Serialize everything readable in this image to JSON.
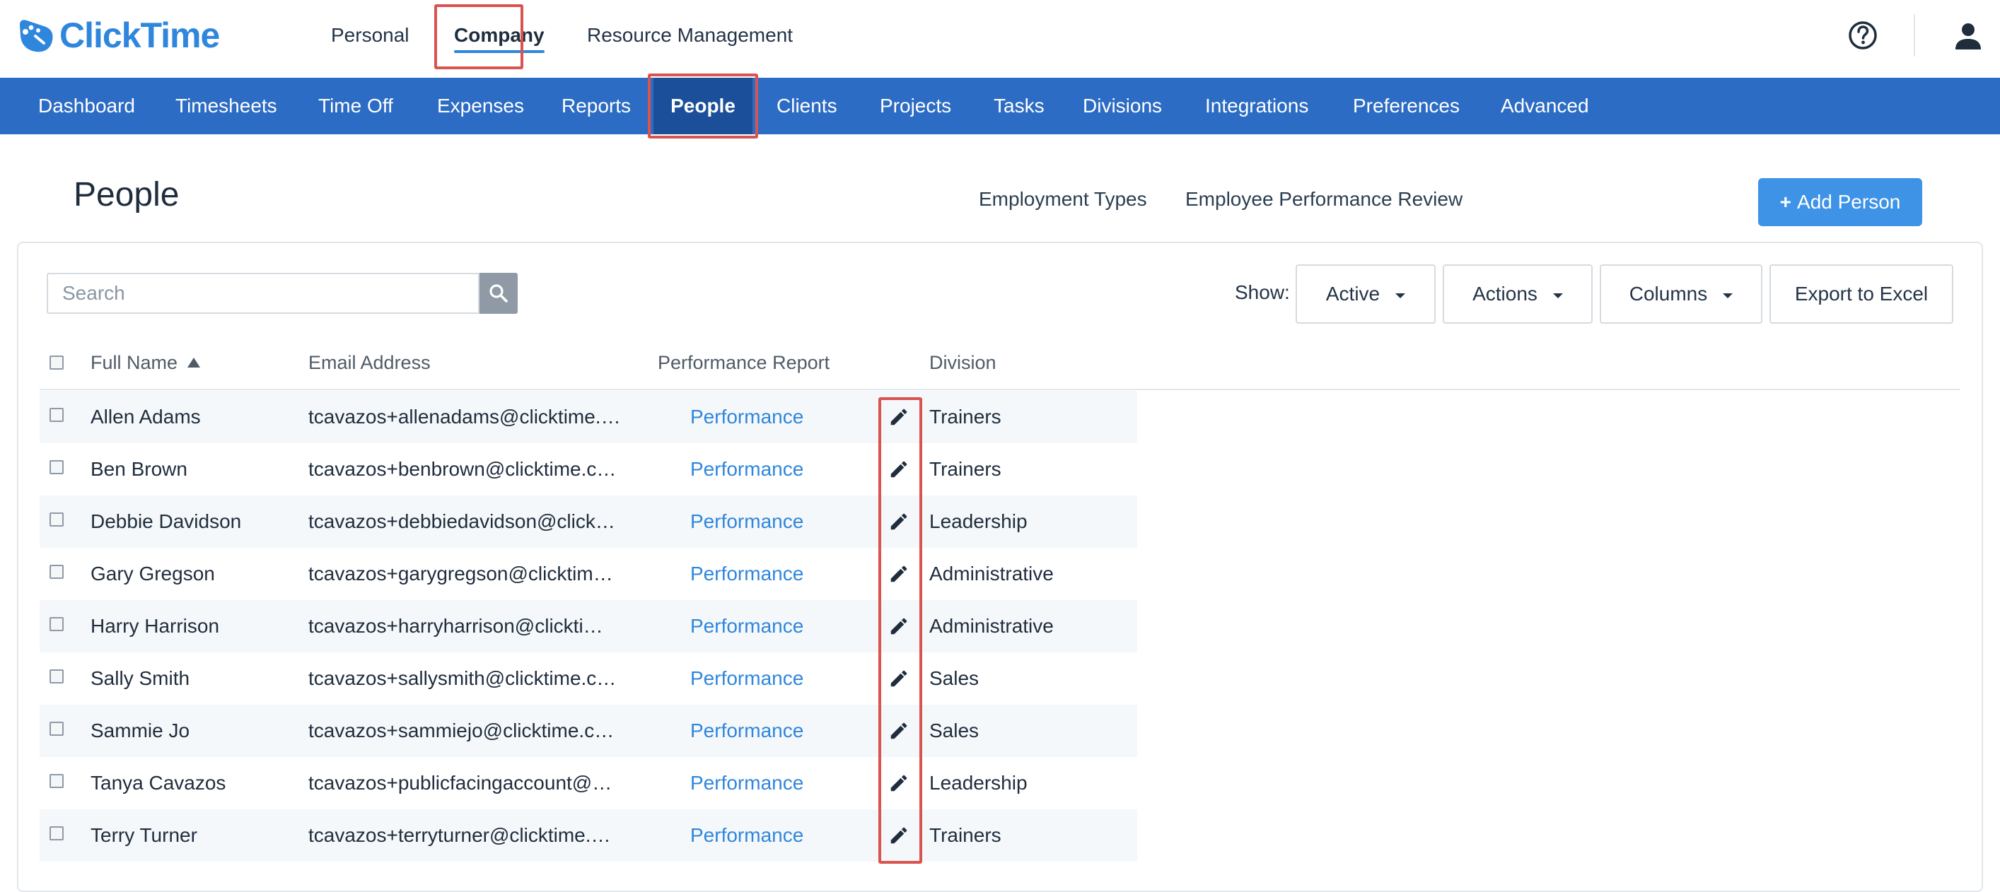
{
  "app": {
    "logo_text": "ClickTime",
    "brand_color": "#2f86dd",
    "nav_color": "#2c6cc4",
    "highlight_color": "#d9534f"
  },
  "topnav": {
    "items": [
      "Personal",
      "Company",
      "Resource Management"
    ],
    "active": "Company"
  },
  "mainnav": {
    "items": [
      "Dashboard",
      "Timesheets",
      "Time Off",
      "Expenses",
      "Reports",
      "People",
      "Clients",
      "Projects",
      "Tasks",
      "Divisions",
      "Integrations",
      "Preferences",
      "Advanced"
    ],
    "active": "People"
  },
  "header": {
    "title": "People",
    "links": [
      "Employment Types",
      "Employee Performance Review"
    ],
    "add_button": "Add Person",
    "add_button_icon": "+"
  },
  "toolbar": {
    "search_placeholder": "Search",
    "show_label": "Show:",
    "show_value": "Active",
    "actions_label": "Actions",
    "columns_label": "Columns",
    "export_label": "Export to Excel"
  },
  "table": {
    "columns": [
      "Full Name",
      "Email Address",
      "Performance Report",
      "Division"
    ],
    "sort_column": "Full Name",
    "sort_direction": "ascending",
    "rows": [
      {
        "name": "Allen Adams",
        "email": "tcavazos+allenadams@clicktime.…",
        "report": "Performance",
        "division": "Trainers"
      },
      {
        "name": "Ben Brown",
        "email": "tcavazos+benbrown@clicktime.c…",
        "report": "Performance",
        "division": "Trainers"
      },
      {
        "name": "Debbie Davidson",
        "email": "tcavazos+debbiedavidson@click…",
        "report": "Performance",
        "division": "Leadership"
      },
      {
        "name": "Gary Gregson",
        "email": "tcavazos+garygregson@clicktim…",
        "report": "Performance",
        "division": "Administrative"
      },
      {
        "name": "Harry Harrison",
        "email": "tcavazos+harryharrison@clickti…",
        "report": "Performance",
        "division": "Administrative"
      },
      {
        "name": "Sally Smith",
        "email": "tcavazos+sallysmith@clicktime.c…",
        "report": "Performance",
        "division": "Sales"
      },
      {
        "name": "Sammie Jo",
        "email": "tcavazos+sammiejo@clicktime.c…",
        "report": "Performance",
        "division": "Sales"
      },
      {
        "name": "Tanya Cavazos",
        "email": "tcavazos+publicfacingaccount@…",
        "report": "Performance",
        "division": "Leadership"
      },
      {
        "name": "Terry Turner",
        "email": "tcavazos+terryturner@clicktime.…",
        "report": "Performance",
        "division": "Trainers"
      }
    ]
  }
}
